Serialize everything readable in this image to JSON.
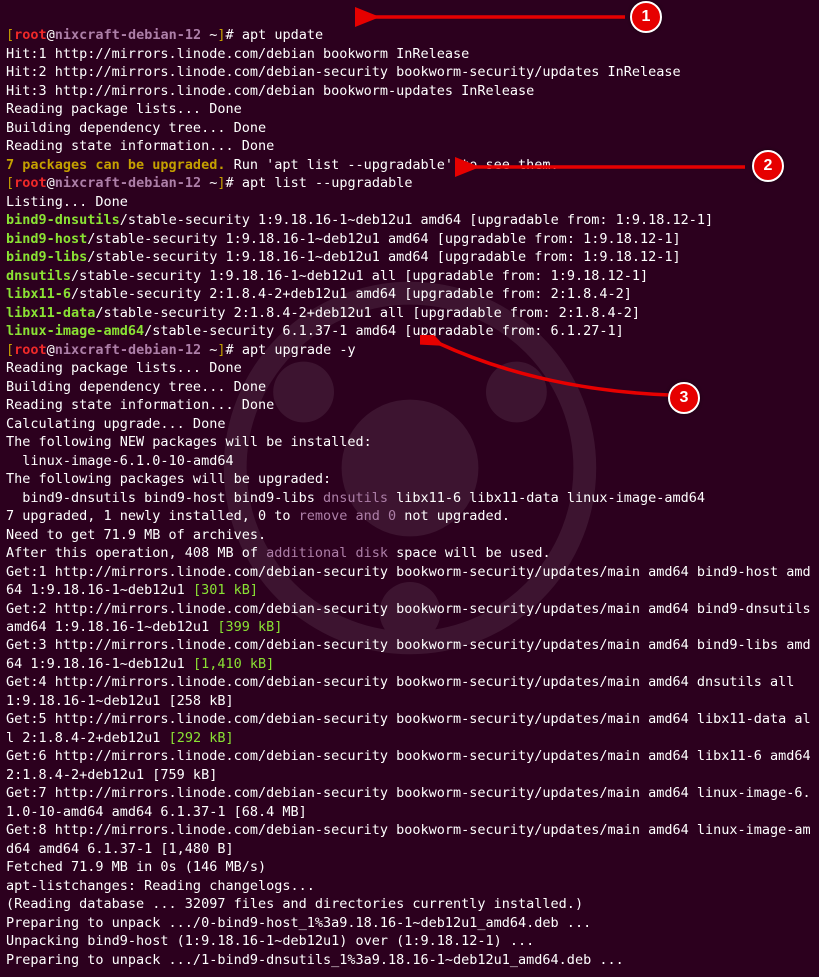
{
  "prompt": {
    "user": "root",
    "at": "@",
    "host": "nixcraft-debian-12",
    "path": "~",
    "hash": "#"
  },
  "cmd1": "apt update",
  "cmd2": "apt list --upgradable",
  "cmd3": "apt upgrade -y",
  "out1": {
    "l1": "Hit:1 http://mirrors.linode.com/debian bookworm InRelease",
    "l2": "Hit:2 http://mirrors.linode.com/debian-security bookworm-security/updates InRelease",
    "l3": "Hit:3 http://mirrors.linode.com/debian bookworm-updates InRelease",
    "l4": "Reading package lists... Done",
    "l5": "Building dependency tree... Done",
    "l6": "Reading state information... Done",
    "l7a": "7 packages can be upgraded.",
    "l7b": " Run 'apt list --upgradable' to see them."
  },
  "out2": {
    "listing": "Listing... Done",
    "pkgs": [
      {
        "name": "bind9-dnsutils",
        "rest": "/stable-security 1:9.18.16-1~deb12u1 amd64 [upgradable from: 1:9.18.12-1]"
      },
      {
        "name": "bind9-host",
        "rest": "/stable-security 1:9.18.16-1~deb12u1 amd64 [upgradable from: 1:9.18.12-1]"
      },
      {
        "name": "bind9-libs",
        "rest": "/stable-security 1:9.18.16-1~deb12u1 amd64 [upgradable from: 1:9.18.12-1]"
      },
      {
        "name": "dnsutils",
        "rest": "/stable-security 1:9.18.16-1~deb12u1 all [upgradable from: 1:9.18.12-1]"
      },
      {
        "name": "libx11-6",
        "rest": "/stable-security 2:1.8.4-2+deb12u1 amd64 [upgradable from: 2:1.8.4-2]"
      },
      {
        "name": "libx11-data",
        "rest": "/stable-security 2:1.8.4-2+deb12u1 all [upgradable from: 2:1.8.4-2]"
      },
      {
        "name": "linux-image-amd64",
        "rest": "/stable-security 6.1.37-1 amd64 [upgradable from: 6.1.27-1]"
      }
    ]
  },
  "out3": {
    "r1": "Reading package lists... Done",
    "r2": "Building dependency tree... Done",
    "r3": "Reading state information... Done",
    "r4": "Calculating upgrade... Done",
    "newtitle": "The following NEW packages will be installed:",
    "newpkgs": "  linux-image-6.1.0-10-amd64",
    "uptitle": "The following packages will be upgraded:",
    "uppkgs_pre": "  bind9-dnsutils bind9-host bind9-libs ",
    "uppkgs_hl": "dnsutils",
    "uppkgs_post": " libx11-6 libx11-data linux-image-amd64",
    "summary_a": "7 upgraded, 1 newly installed, 0 to ",
    "summary_b": "remove and 0",
    "summary_c": " not upgraded.",
    "need": "Need to get 71.9 MB of archives.",
    "after_a": "After this operation, 408 MB of ",
    "after_b": "additional disk",
    "after_c": " space will be used.",
    "gets": [
      {
        "pre": "Get:1 http://mirrors.linode.com/debian-security bookworm-security/updates/main amd64 bind9-host amd64 1:9.18.16-1~deb12u1 ",
        "size": "[301 kB]"
      },
      {
        "pre": "Get:2 http://mirrors.linode.com/debian-security bookworm-security/updates/main amd64 bind9-dnsutils amd64 1:9.18.16-1~deb12u1 ",
        "size": "[399 kB]"
      },
      {
        "pre": "Get:3 http://mirrors.linode.com/debian-security bookworm-security/updates/main amd64 bind9-libs amd64 1:9.18.16-1~deb12u1 ",
        "size": "[1,410 kB]"
      },
      {
        "pre": "Get:4 http://mirrors.linode.com/debian-security bookworm-security/updates/main amd64 dnsutils all 1:9.18.16-1~deb12u1 [258 kB]",
        "size": ""
      },
      {
        "pre": "Get:5 http://mirrors.linode.com/debian-security bookworm-security/updates/main amd64 libx11-data all 2:1.8.4-2+deb12u1 ",
        "size": "[292 kB]"
      },
      {
        "pre": "Get:6 http://mirrors.linode.com/debian-security bookworm-security/updates/main amd64 libx11-6 amd64 2:1.8.4-2+deb12u1 [759 kB]",
        "size": ""
      },
      {
        "pre": "Get:7 http://mirrors.linode.com/debian-security bookworm-security/updates/main amd64 linux-image-6.1.0-10-amd64 amd64 6.1.37-1 [68.4 MB]",
        "size": ""
      },
      {
        "pre": "Get:8 http://mirrors.linode.com/debian-security bookworm-security/updates/main amd64 linux-image-amd64 amd64 6.1.37-1 [1,480 B]",
        "size": ""
      }
    ],
    "fetched": "Fetched 71.9 MB in 0s (146 MB/s)",
    "changelog": "apt-listchanges: Reading changelogs...",
    "readdb": "(Reading database ... 32097 files and directories currently installed.)",
    "prep1": "Preparing to unpack .../0-bind9-host_1%3a9.18.16-1~deb12u1_amd64.deb ...",
    "unpack1": "Unpacking bind9-host (1:9.18.16-1~deb12u1) over (1:9.18.12-1) ...",
    "prep2": "Preparing to unpack .../1-bind9-dnsutils_1%3a9.18.16-1~deb12u1_amd64.deb ..."
  },
  "badges": {
    "n1": "1",
    "n2": "2",
    "n3": "3"
  }
}
